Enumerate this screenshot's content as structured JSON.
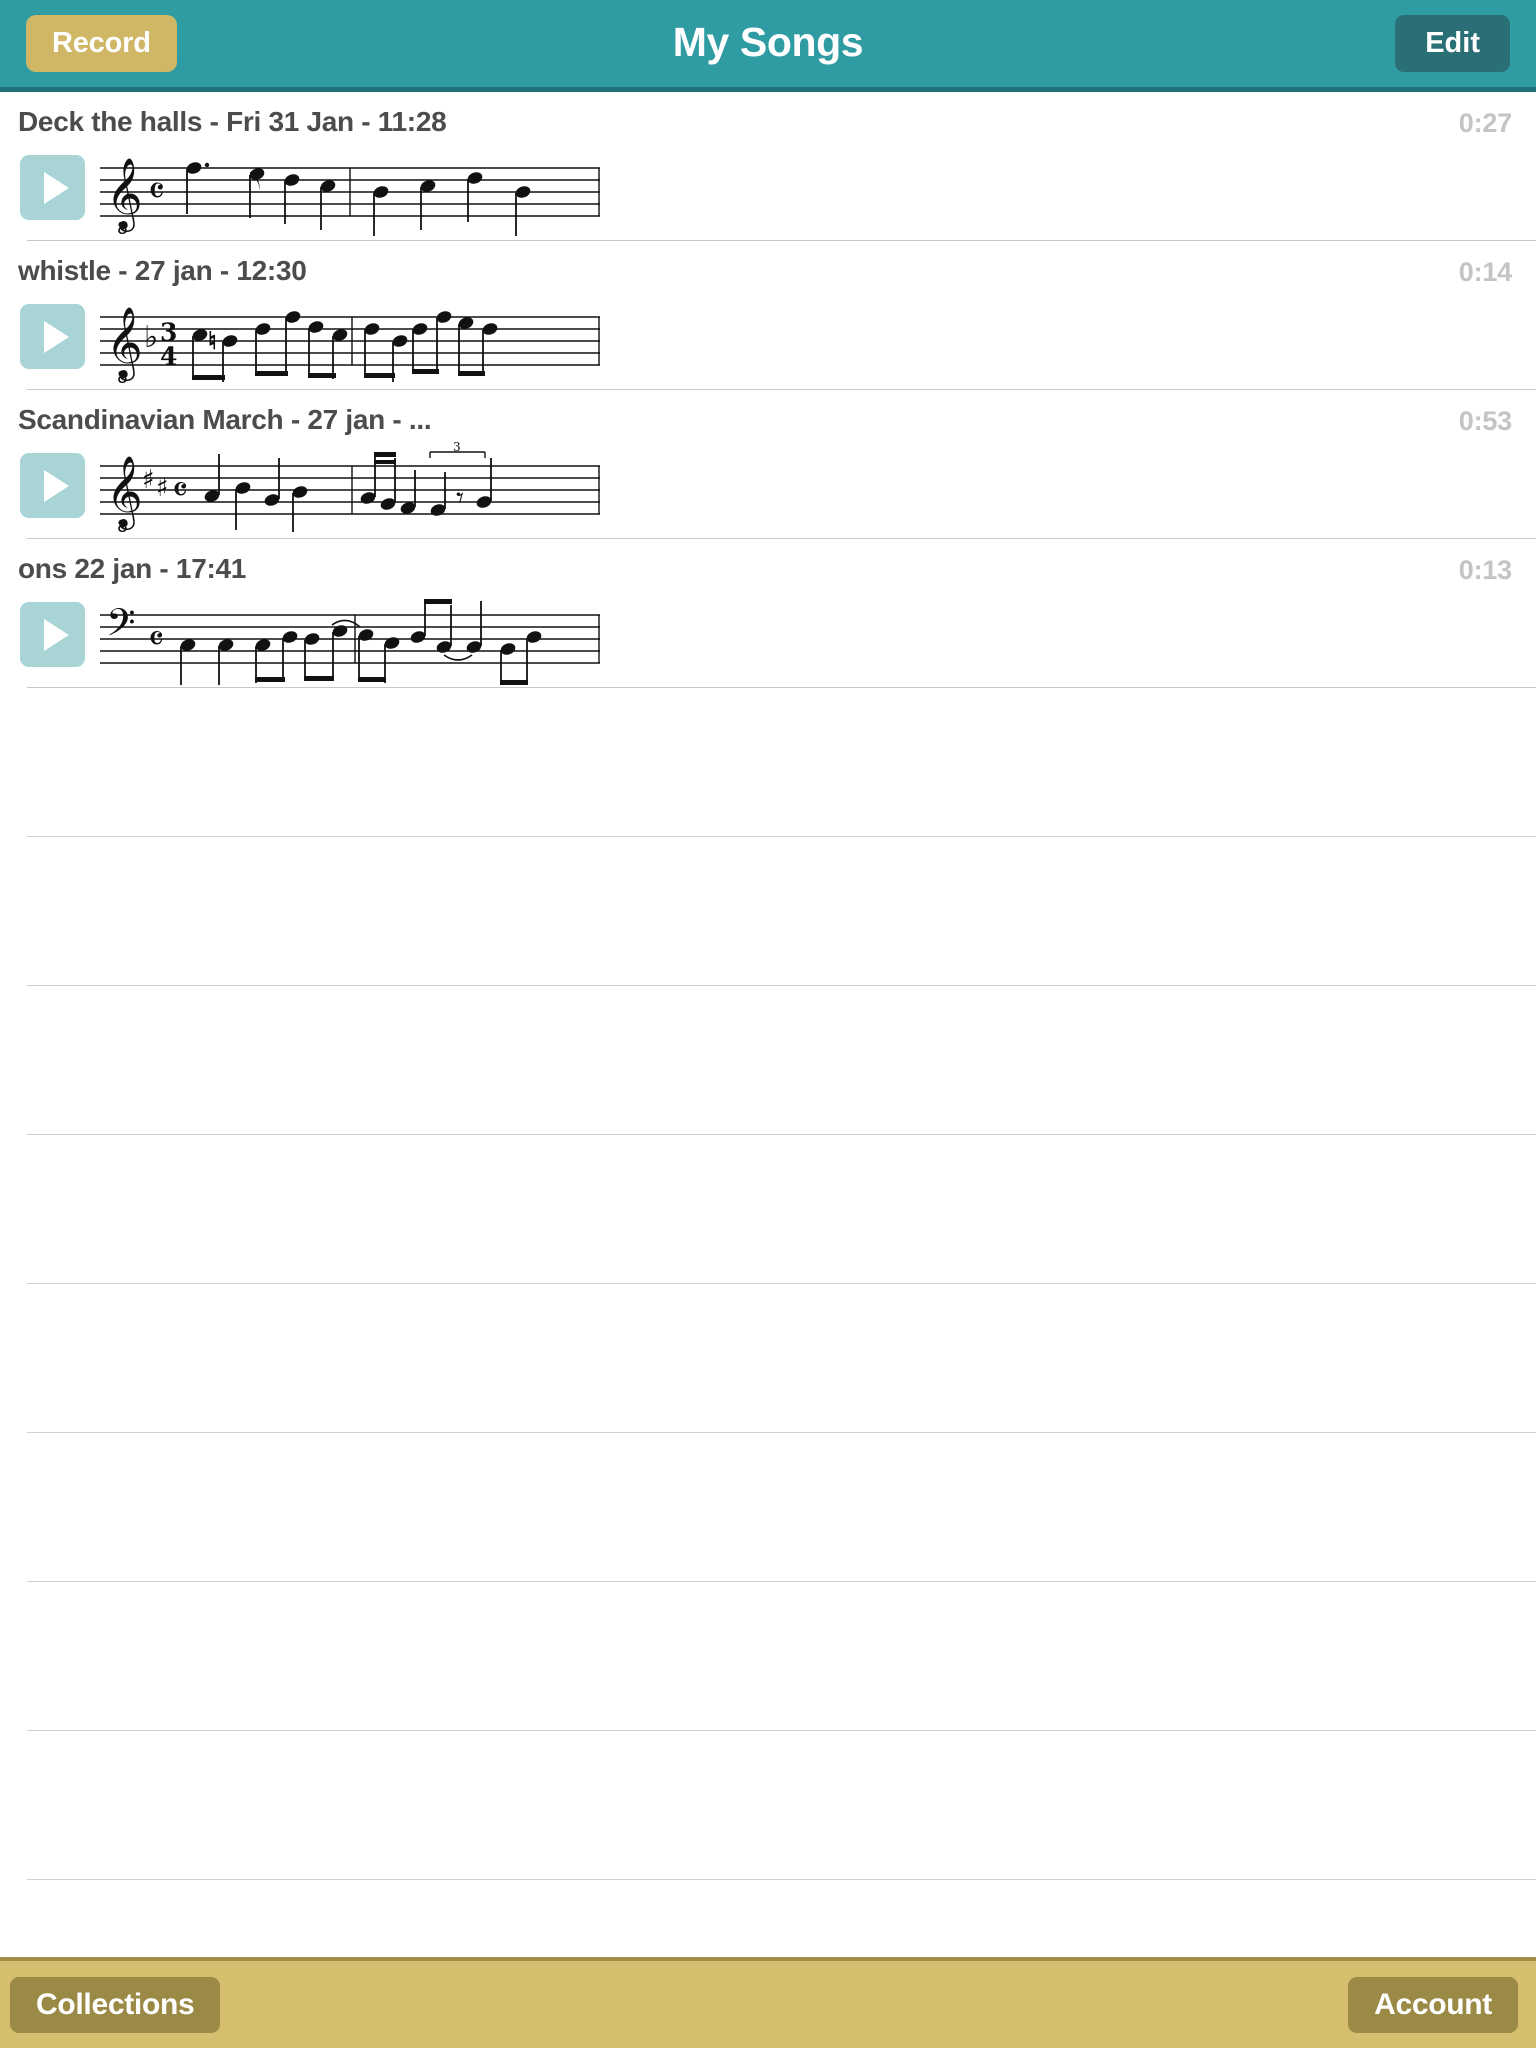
{
  "app": {
    "theme": {
      "nav_background": "#2f9ca3",
      "nav_border": "#1d7077",
      "record_button_background": "#cfb765",
      "edit_button_background": "#2a6f76",
      "play_button_background": "#a8d4d6",
      "toolbar_background": "#d5bf6e",
      "toolbar_button_background": "#9b8a45",
      "title_text": "#4c4c4c",
      "duration_text": "#c4c4c4",
      "separator": "#c9c9c9"
    }
  },
  "navbar": {
    "title": "My Songs",
    "record_label": "Record",
    "edit_label": "Edit"
  },
  "songs": [
    {
      "title": "Deck the halls - Fri 31 Jan - 11:28",
      "duration": "0:27",
      "play_icon": "play-icon",
      "notation": {
        "clef": "treble-8vb",
        "key_signature": "",
        "time_signature": "common",
        "measures": 2
      }
    },
    {
      "title": "whistle - 27 jan - 12:30",
      "duration": "0:14",
      "play_icon": "play-icon",
      "notation": {
        "clef": "treble-8vb",
        "key_signature": "1-flat",
        "time_signature": "3/4",
        "measures": 2
      }
    },
    {
      "title": "Scandinavian March - 27 jan - ...",
      "duration": "0:53",
      "play_icon": "play-icon",
      "notation": {
        "clef": "treble-8vb",
        "key_signature": "2-sharps",
        "time_signature": "common",
        "measures": 2
      }
    },
    {
      "title": "ons 22 jan - 17:41",
      "duration": "0:13",
      "play_icon": "play-icon",
      "notation": {
        "clef": "bass",
        "key_signature": "",
        "time_signature": "common",
        "measures": 2
      }
    }
  ],
  "empty_rows": 9,
  "toolbar": {
    "collections_label": "Collections",
    "account_label": "Account"
  }
}
